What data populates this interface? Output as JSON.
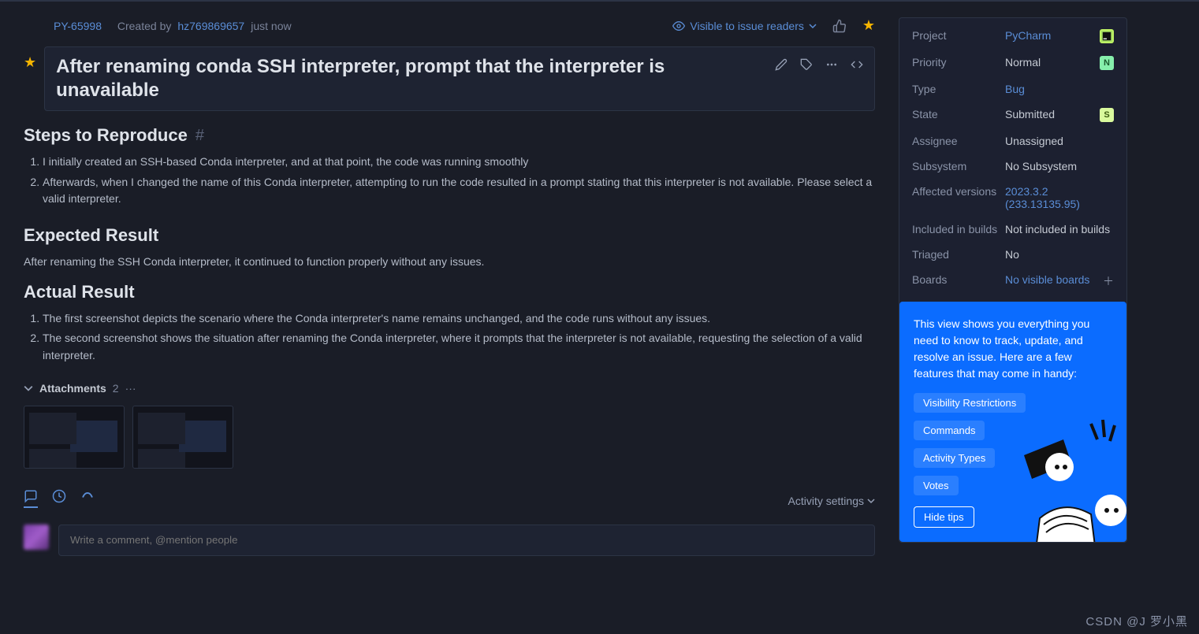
{
  "header": {
    "issue_id": "PY-65998",
    "created_by_prefix": "Created by",
    "author": "hz769869657",
    "time": "just now",
    "visibility": "Visible to issue readers"
  },
  "title": "After renaming conda SSH interpreter, prompt that the interpreter is unavailable",
  "sections": {
    "steps_h": "Steps to Reproduce",
    "step1": "I initially created an SSH-based Conda interpreter, and at that point, the code was running smoothly",
    "step2": "Afterwards, when I changed the name of this Conda interpreter, attempting to run the code resulted in a prompt stating that this interpreter is not available. Please select a valid interpreter.",
    "expected_h": "Expected Result",
    "expected_p": "After renaming the SSH Conda interpreter, it continued to function properly without any issues.",
    "actual_h": "Actual Result",
    "actual1": "The first screenshot depicts the scenario where the Conda interpreter's name remains unchanged, and the code runs without any issues.",
    "actual2": "The second screenshot shows the situation after renaming the Conda interpreter, where it prompts that the interpreter is not available, requesting the selection of a valid interpreter."
  },
  "attachments": {
    "label": "Attachments",
    "count": "2"
  },
  "activity": {
    "settings": "Activity settings"
  },
  "comment": {
    "placeholder": "Write a comment, @mention people"
  },
  "fields": {
    "project": {
      "label": "Project",
      "value": "PyCharm"
    },
    "priority": {
      "label": "Priority",
      "value": "Normal",
      "badge": "N"
    },
    "type": {
      "label": "Type",
      "value": "Bug"
    },
    "state": {
      "label": "State",
      "value": "Submitted",
      "badge": "S"
    },
    "assignee": {
      "label": "Assignee",
      "value": "Unassigned"
    },
    "subsystem": {
      "label": "Subsystem",
      "value": "No Subsystem"
    },
    "affected": {
      "label": "Affected versions",
      "value": "2023.3.2 (233.13135.95)"
    },
    "included": {
      "label": "Included in builds",
      "value": "Not included in builds"
    },
    "triaged": {
      "label": "Triaged",
      "value": "No"
    },
    "boards": {
      "label": "Boards",
      "value": "No visible boards"
    }
  },
  "tips": {
    "text": "This view shows you everything you need to know to track, update, and resolve an issue. Here are a few features that may come in handy:",
    "chips": [
      "Visibility Restrictions",
      "Commands",
      "Activity Types",
      "Votes"
    ],
    "hide": "Hide tips"
  },
  "watermark": "CSDN @J 罗小黑"
}
